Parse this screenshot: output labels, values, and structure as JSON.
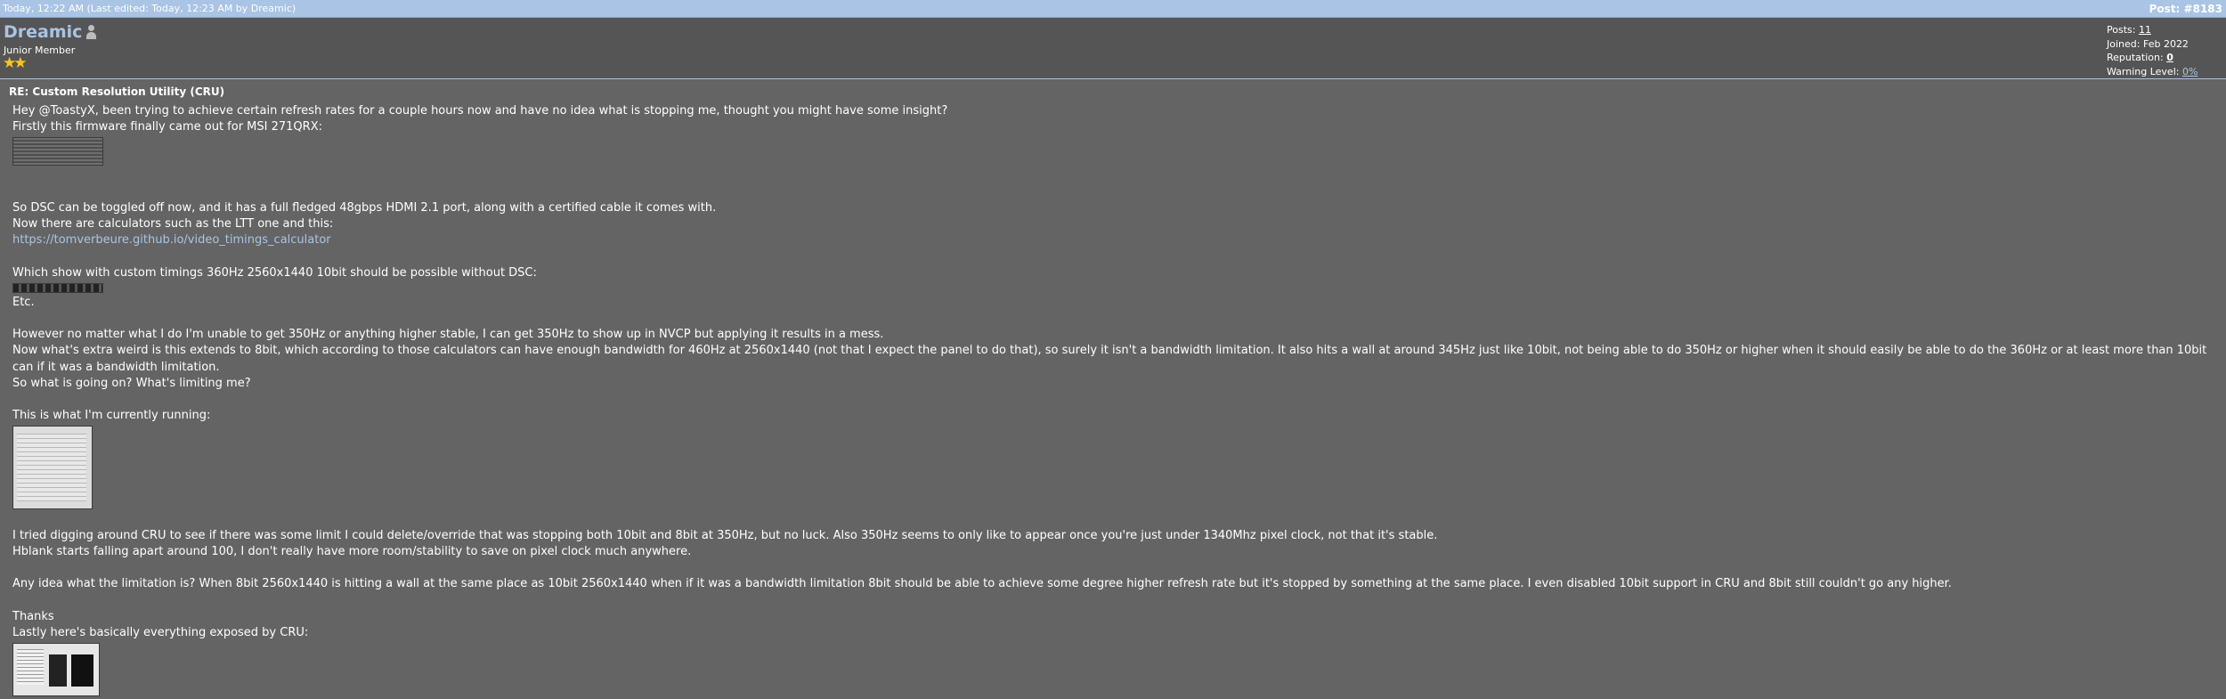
{
  "topbar": {
    "timestamp": "Today, 12:22 AM (Last edited: Today, 12:23 AM by Dreamic)",
    "post_number": "Post: #8183"
  },
  "author": {
    "username": "Dreamic",
    "usertitle": "Junior Member",
    "stars": "★★",
    "stats": {
      "posts_label": "Posts:",
      "posts_value": "11",
      "joined_label": "Joined:",
      "joined_value": "Feb 2022",
      "reputation_label": "Reputation:",
      "reputation_value": "0",
      "warning_label": "Warning Level:",
      "warning_value": "0%"
    }
  },
  "post": {
    "subject": "RE: Custom Resolution Utility (CRU)",
    "lines": [
      "Hey @ToastyX, been trying to achieve certain refresh rates for a couple hours now and have no idea what is stopping me, thought you might have some insight?",
      "Firstly this firmware finally came out for MSI 271QRX:",
      "So DSC can be toggled off now, and it has a full fledged 48gbps HDMI 2.1 port, along with a certified cable it comes with.",
      "Now there are calculators such as the LTT one and this:",
      "https://tomverbeure.github.io/video_timings_calculator",
      "Which show with custom timings 360Hz 2560x1440 10bit should be possible without DSC:",
      "Etc.",
      "However no matter what I do I'm unable to get 350Hz or anything higher stable, I can get 350Hz to show up in NVCP but applying it results in a mess.",
      "Now what's extra weird is this extends to 8bit, which according to those calculators can have enough bandwidth for 460Hz at 2560x1440 (not that I expect the panel to do that), so surely it isn't a bandwidth limitation. It also hits a wall at around 345Hz just like 10bit, not being able to do 350Hz or higher when it should easily be able to do the 360Hz or at least more than 10bit can if it was a bandwidth limitation.",
      "So what is going on? What's limiting me?",
      "This is what I'm currently running:",
      "I tried digging around CRU to see if there was some limit I could delete/override that was stopping both 10bit and 8bit at 350Hz, but no luck. Also 350Hz seems to only like to appear once you're just under 1340Mhz pixel clock, not that it's stable.",
      "Hblank starts falling apart around 100, I don't really have more room/stability to save on pixel clock much anywhere.",
      "Any idea what the limitation is? When 8bit 2560x1440 is hitting a wall at the same place as 10bit 2560x1440 when if it was a bandwidth limitation 8bit should be able to achieve some degree higher refresh rate but it's stopped by something at the same place. I even disabled 10bit support in CRU and 8bit still couldn't go any higher.",
      "Thanks",
      "Lastly here's basically everything exposed by CRU:"
    ]
  }
}
